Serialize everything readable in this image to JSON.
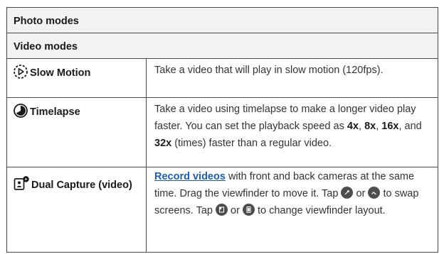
{
  "sections": {
    "photo_modes": "Photo modes",
    "video_modes": "Video modes"
  },
  "rows": {
    "slow_motion": {
      "icon": "slow-motion-icon",
      "name": "Slow Motion",
      "desc": "Take a video that will play in slow motion (120fps)."
    },
    "timelapse": {
      "icon": "timelapse-icon",
      "name": "Timelapse",
      "desc_prefix": "Take a video using timelapse to make a longer video play faster. You can set the playback speed as ",
      "speed_1": "4x",
      "sep_1": ", ",
      "speed_2": "8x",
      "sep_2": ", ",
      "speed_3": "16x",
      "sep_3": ", and ",
      "speed_4": "32x",
      "desc_suffix": " (times) faster than a regular video."
    },
    "dual_capture": {
      "icon": "dual-capture-icon",
      "name": "Dual Capture (video)",
      "link": "Record videos",
      "text_1": " with front and back cameras at the same time. Drag the viewfinder to move it. Tap ",
      "or_1": " or ",
      "text_2": " to swap screens. Tap ",
      "or_2": " or ",
      "text_3": " to change viewfinder layout.",
      "chip_icons": [
        "swap-screens-icon",
        "swap-screens-alt-icon",
        "layout-icon",
        "layout-alt-icon"
      ]
    }
  }
}
